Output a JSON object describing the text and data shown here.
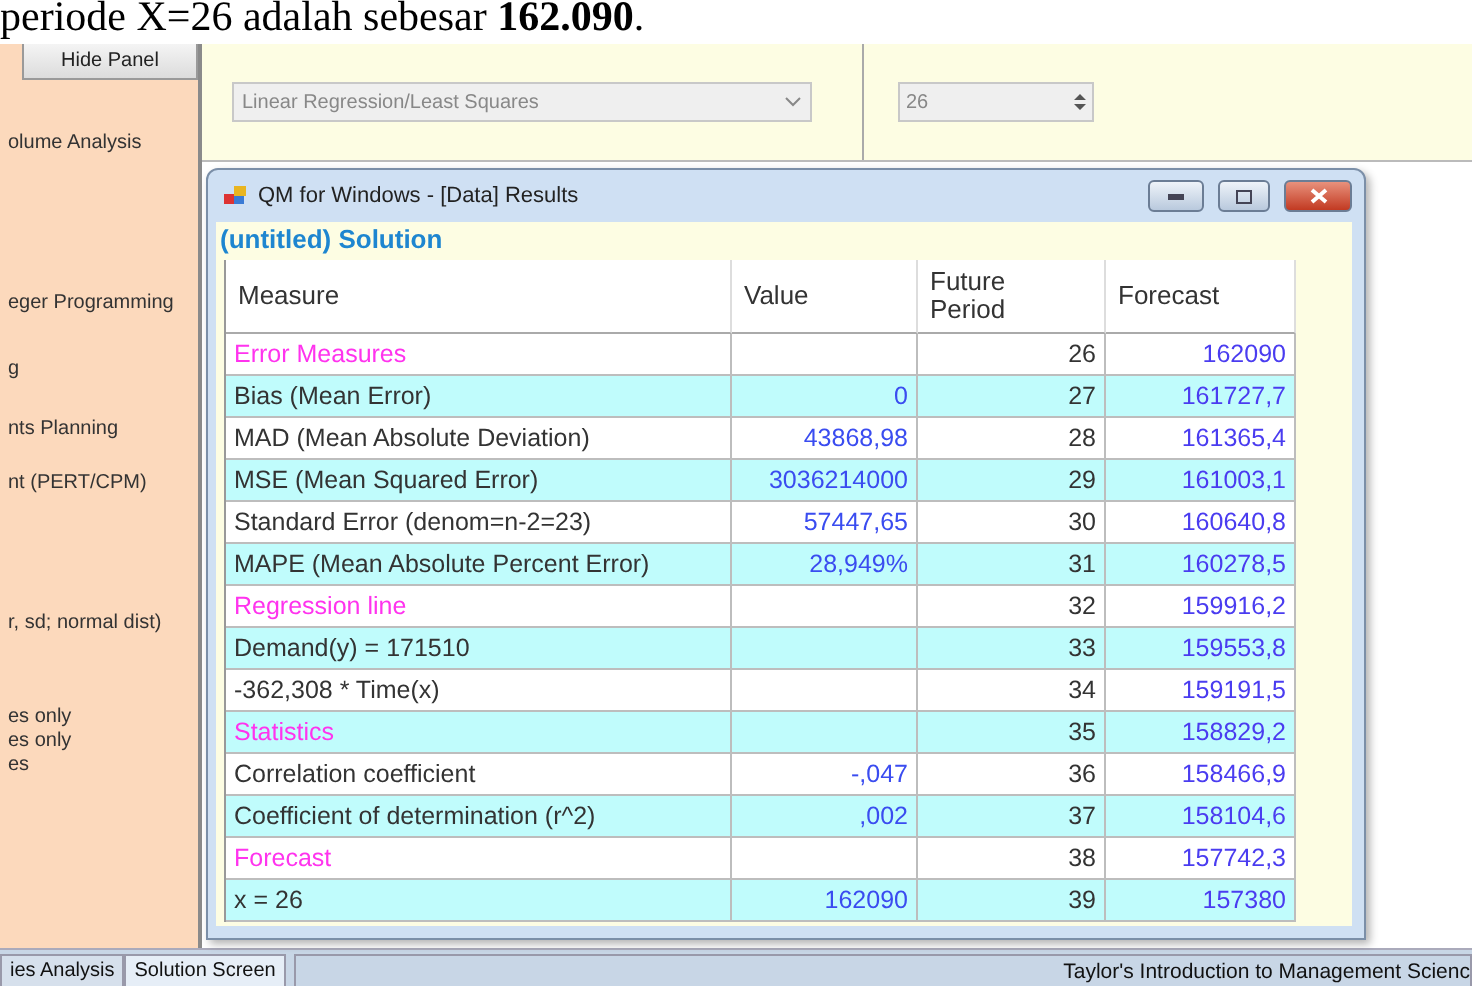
{
  "document_line": "periode X=26 adalah sebesar **162.090**.",
  "side_panel": {
    "button": "Hide Panel",
    "items": [
      "olume Analysis",
      "eger Programming",
      "g",
      "nts Planning",
      "nt (PERT/CPM)",
      "r, sd; normal dist)",
      "es only",
      "es only",
      "es"
    ]
  },
  "settings": {
    "method": "Linear Regression/Least Squares",
    "period": "26"
  },
  "results_window": {
    "title": "QM for Windows - [Data] Results",
    "heading": "(untitled) Solution",
    "columns": [
      "Measure",
      "Value",
      "Future Period",
      "Forecast"
    ],
    "rows": [
      {
        "kind": "section",
        "measure": "Error Measures",
        "value": "",
        "period": "26",
        "forecast": "162090"
      },
      {
        "kind": "data",
        "measure": "Bias (Mean Error)",
        "value": "0",
        "period": "27",
        "forecast": "161727,7"
      },
      {
        "kind": "data",
        "measure": "MAD (Mean Absolute Deviation)",
        "value": "43868,98",
        "period": "28",
        "forecast": "161365,4"
      },
      {
        "kind": "data",
        "measure": "MSE (Mean Squared Error)",
        "value": "3036214000",
        "period": "29",
        "forecast": "161003,1"
      },
      {
        "kind": "data",
        "measure": "Standard Error (denom=n-2=23)",
        "value": "57447,65",
        "period": "30",
        "forecast": "160640,8"
      },
      {
        "kind": "data",
        "measure": "MAPE (Mean Absolute Percent Error)",
        "value": "28,949%",
        "period": "31",
        "forecast": "160278,5"
      },
      {
        "kind": "section",
        "measure": "Regression line",
        "value": "",
        "period": "32",
        "forecast": "159916,2"
      },
      {
        "kind": "data",
        "measure": "Demand(y) = 171510",
        "value": "",
        "period": "33",
        "forecast": "159553,8"
      },
      {
        "kind": "data",
        "measure": "-362,308 * Time(x)",
        "value": "",
        "period": "34",
        "forecast": "159191,5"
      },
      {
        "kind": "section",
        "measure": "Statistics",
        "value": "",
        "period": "35",
        "forecast": "158829,2"
      },
      {
        "kind": "data",
        "measure": "Correlation coefficient",
        "value": "-,047",
        "period": "36",
        "forecast": "158466,9"
      },
      {
        "kind": "data",
        "measure": "Coefficient of determination (r^2)",
        "value": ",002",
        "period": "37",
        "forecast": "158104,6"
      },
      {
        "kind": "section",
        "measure": "Forecast",
        "value": "",
        "period": "38",
        "forecast": "157742,3"
      },
      {
        "kind": "data",
        "measure": "x = 26",
        "value": "162090",
        "period": "39",
        "forecast": "157380"
      }
    ]
  },
  "status_bar": {
    "tabs": [
      {
        "label": "ies Analysis",
        "selected": false
      },
      {
        "label": "Solution Screen",
        "selected": true
      }
    ],
    "text": "Taylor's Introduction to Management Scienc"
  }
}
